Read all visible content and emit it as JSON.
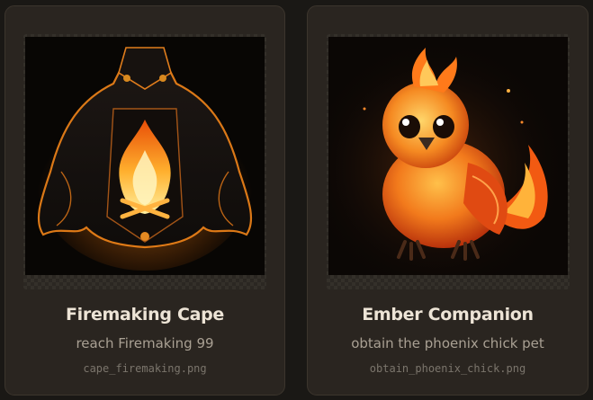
{
  "achievements": [
    {
      "title": "Firemaking Cape",
      "description": "reach Firemaking 99",
      "filename": "cape_firemaking.png",
      "icon": "firemaking-cape-icon"
    },
    {
      "title": "Ember Companion",
      "description": "obtain the phoenix chick pet",
      "filename": "obtain_phoenix_chick.png",
      "icon": "phoenix-chick-icon"
    }
  ]
}
